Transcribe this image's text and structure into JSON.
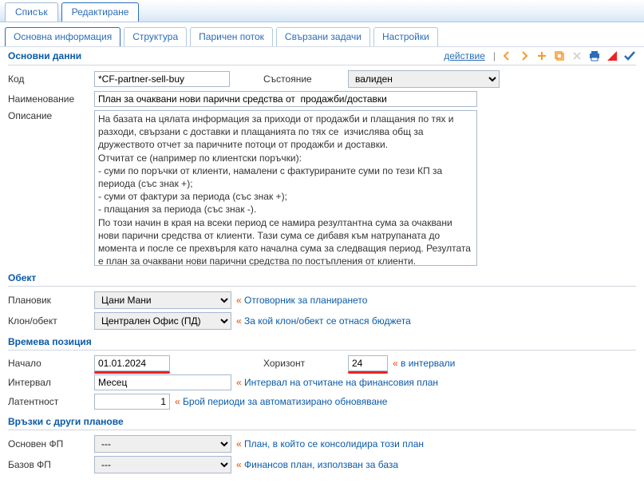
{
  "topTabs": {
    "list": "Списък",
    "edit": "Редактиране"
  },
  "innerTabs": {
    "main": "Основна информация",
    "structure": "Структура",
    "cashflow": "Паричен поток",
    "tasks": "Свързани задачи",
    "settings": "Настройки"
  },
  "toolbar": {
    "action": "действие"
  },
  "sections": {
    "basic": "Основни данни",
    "object": "Обект",
    "timepos": "Времева позиция",
    "links": "Връзки с други планове"
  },
  "labels": {
    "code": "Код",
    "state": "Състояние",
    "name": "Наименование",
    "desc": "Описание",
    "planner": "Плановик",
    "branch": "Клон/обект",
    "start": "Начало",
    "horizon": "Хоризонт",
    "interval": "Интервал",
    "latency": "Латентност",
    "mainfp": "Основен ФП",
    "basefp": "Базов ФП"
  },
  "values": {
    "code": "*CF-partner-sell-buy",
    "state": "валиден",
    "name": "План за очаквани нови парични средства от  продажби/доставки",
    "desc": "На базата на цялата информация за приходи от продажби и плащания по тях и разходи, свързани с доставки и плащанията по тях се  изчислява общ за дружеството отчет за паричните потоци от продажби и доставки.\nОтчитат се (например по клиентски поръчки):\n- суми по поръчки от клиенти, намалени с фактурираните суми по тези КП за периода (със знак +);\n- суми от фактури за периода (със знак +);\n- плащания за периода (със знак -).\nПо този начин в края на всеки период се намира резултантна сума за очаквани нови парични средства от клиенти. Тази сума се дибавя към натрупаната до момента и после се прехвърля като начална сума за следващия период. Резултата е план за очаквани нови парични средства по постъпления от клиенти.\nАналогично се работи и по поръчките към доставчици.",
    "planner": "Цани Мани",
    "branch": "Централен Офис (ПД)",
    "start": "01.01.2024",
    "horizon": "24",
    "interval": "Месец",
    "latency": "1",
    "mainfp": "---",
    "basefp": "---"
  },
  "hints": {
    "planner": "Отговорник за планирането",
    "branch": "За кой клон/обект се отнася бюджета",
    "horizon": "в интервали",
    "interval": "Интервал на отчитане на финансовия план",
    "latency": "Брой периоди за автоматизирано обновяване",
    "mainfp": "План, в който се консолидира този план",
    "basefp": "Финансов план, използван за база"
  }
}
